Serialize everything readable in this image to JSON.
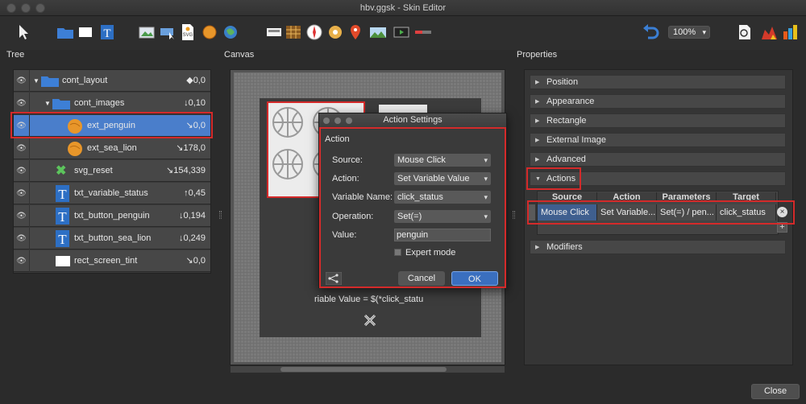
{
  "window": {
    "title": "hbv.ggsk - Skin Editor"
  },
  "toolbar": {
    "zoom": "100%"
  },
  "panels": {
    "tree": "Tree",
    "canvas": "Canvas",
    "properties": "Properties"
  },
  "tree": {
    "rows": [
      {
        "name": "cont_layout",
        "value": "◆0,0"
      },
      {
        "name": "cont_images",
        "value": "↓0,10"
      },
      {
        "name": "ext_penguin",
        "value": "↘0,0"
      },
      {
        "name": "ext_sea_lion",
        "value": "↘178,0"
      },
      {
        "name": "svg_reset",
        "value": "↘154,339"
      },
      {
        "name": "txt_variable_status",
        "value": "↑0,45"
      },
      {
        "name": "txt_button_penguin",
        "value": "↓0,194"
      },
      {
        "name": "txt_button_sea_lion",
        "value": "↓0,249"
      },
      {
        "name": "rect_screen_tint",
        "value": "↘0,0"
      }
    ]
  },
  "canvas": {
    "text": "riable Value = $(*click_statu"
  },
  "dialog": {
    "title": "Action Settings",
    "section": "Action",
    "source_label": "Source:",
    "source_value": "Mouse Click",
    "action_label": "Action:",
    "action_value": "Set Variable Value",
    "varname_label": "Variable Name:",
    "varname_value": "click_status",
    "operation_label": "Operation:",
    "operation_value": "Set(=)",
    "value_label": "Value:",
    "value_value": "penguin",
    "expert_label": "Expert mode",
    "cancel": "Cancel",
    "ok": "OK"
  },
  "properties": {
    "sections": [
      "Position",
      "Appearance",
      "Rectangle",
      "External Image",
      "Advanced",
      "Actions",
      "Modifiers"
    ],
    "table": {
      "headers": [
        "Source",
        "Action",
        "Parameters",
        "Target"
      ],
      "row": [
        "Mouse Click",
        "Set Variable...",
        "Set(=) / pen...",
        "click_status"
      ]
    }
  },
  "footer": {
    "close": "Close"
  }
}
